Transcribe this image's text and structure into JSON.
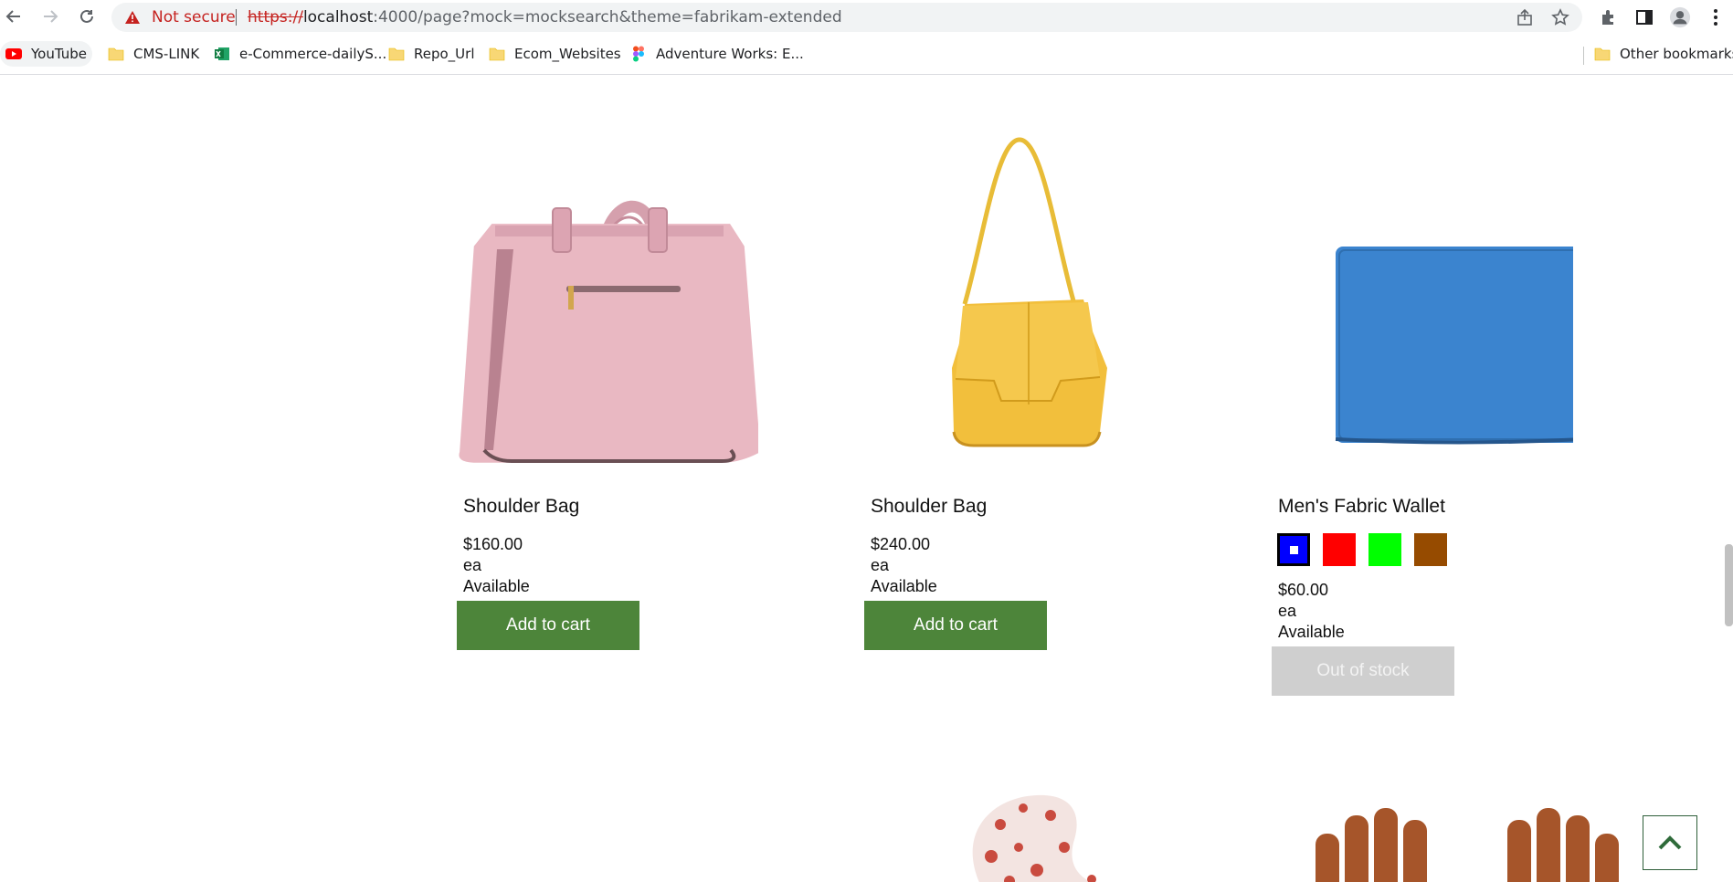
{
  "browser": {
    "security_label": "Not secure",
    "url_scheme": "https://",
    "url_host": "localhost",
    "url_rest": ":4000/page?mock=mocksearch&theme=fabrikam-extended",
    "bookmarks": [
      {
        "label": "YouTube",
        "icon": "youtube-icon"
      },
      {
        "label": "CMS-LINK",
        "icon": "folder-icon"
      },
      {
        "label": "e-Commerce-dailyS...",
        "icon": "excel-icon"
      },
      {
        "label": "Repo_Url",
        "icon": "folder-icon"
      },
      {
        "label": "Ecom_Websites",
        "icon": "folder-icon"
      },
      {
        "label": "Adventure Works: E...",
        "icon": "figma-icon"
      }
    ],
    "other_bookmarks": "Other bookmarks"
  },
  "products": [
    {
      "name": "Shoulder Bag",
      "price": "$160.00",
      "unit": "ea",
      "availability": "Available",
      "button": "Add to cart",
      "image": "pink-handbag"
    },
    {
      "name": "Shoulder Bag",
      "price": "$240.00",
      "unit": "ea",
      "availability": "Available",
      "button": "Add to cart",
      "image": "yellow-shoulder-bag"
    },
    {
      "name": "Men's Fabric Wallet",
      "swatches": [
        {
          "color": "#0000ff",
          "selected": true
        },
        {
          "color": "#ff0000",
          "selected": false
        },
        {
          "color": "#00ff00",
          "selected": false
        },
        {
          "color": "#964b00",
          "selected": false
        }
      ],
      "price": "$60.00",
      "unit": "ea",
      "availability": "Available",
      "button": "Out of stock",
      "image": "blue-wallet"
    }
  ],
  "colors": {
    "button_green": "#4d853a",
    "button_disabled": "#cfcfcf"
  },
  "icons": [
    "back-arrow-icon",
    "forward-arrow-icon",
    "reload-icon",
    "warning-icon",
    "share-icon",
    "star-icon",
    "extensions-icon",
    "side-panel-icon",
    "profile-icon",
    "more-icon",
    "chevron-up-icon"
  ]
}
